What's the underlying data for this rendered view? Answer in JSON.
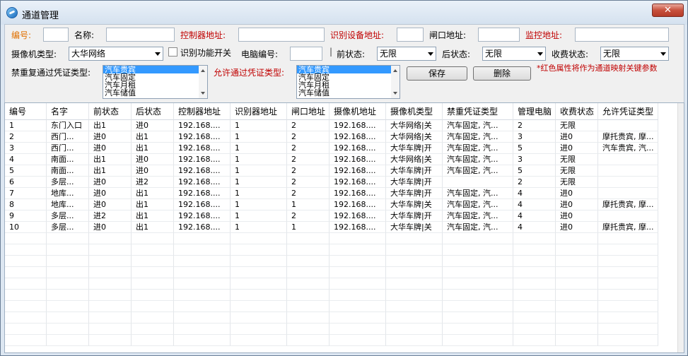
{
  "window": {
    "title": "通道管理",
    "close_label": "✕"
  },
  "form": {
    "number_label": "编号:",
    "name_label": "名称:",
    "controller_addr_label": "控制器地址:",
    "recognizer_addr_label": "识别设备地址:",
    "gate_addr_label": "闸口地址:",
    "monitor_addr_label": "监控地址:",
    "camera_type_label": "摄像机类型:",
    "camera_type_value": "大华网络",
    "recognition_switch_label": "识别功能开关",
    "pc_number_label": "电脑编号:",
    "front_state_label": "前状态:",
    "front_state_value": "无限",
    "back_state_label": "后状态:",
    "back_state_value": "无限",
    "charge_state_label": "收费状态:",
    "charge_state_value": "无限",
    "forbid_label": "禁重复通过凭证类型:",
    "allow_label": "允许通过凭证类型:",
    "forbid_list": [
      "汽车贵宾",
      "汽车固定",
      "汽车月租",
      "汽车储值"
    ],
    "allow_list": [
      "汽车贵宾",
      "汽车固定",
      "汽车月租",
      "汽车储值"
    ],
    "save_label": "保存",
    "delete_label": "删除",
    "note": "*红色属性将作为通道映射关键参数"
  },
  "table": {
    "headers": [
      "编号",
      "名字",
      "前状态",
      "后状态",
      "控制器地址",
      "识别器地址",
      "闸口地址",
      "摄像机地址",
      "摄像机类型",
      "禁重凭证类型",
      "管理电脑",
      "收费状态",
      "允许凭证类型"
    ],
    "rows": [
      [
        "1",
        "东门入口",
        "出1",
        "进0",
        "192.168....",
        "1",
        "2",
        "192.168....",
        "大华网络|关",
        "汽车固定, 汽...",
        "2",
        "无限",
        ""
      ],
      [
        "2",
        "西门...",
        "进0",
        "出1",
        "192.168....",
        "1",
        "2",
        "192.168....",
        "大华网络|关",
        "汽车固定, 汽...",
        "3",
        "进0",
        "摩托贵宾, 摩..."
      ],
      [
        "3",
        "西门...",
        "进0",
        "出1",
        "192.168....",
        "1",
        "2",
        "192.168....",
        "大华车牌|开",
        "汽车固定, 汽...",
        "5",
        "进0",
        "汽车贵宾, 汽..."
      ],
      [
        "4",
        "南面...",
        "出1",
        "进0",
        "192.168....",
        "1",
        "2",
        "192.168....",
        "大华网络|关",
        "汽车固定, 汽...",
        "3",
        "无限",
        ""
      ],
      [
        "5",
        "南面...",
        "出1",
        "进0",
        "192.168....",
        "1",
        "2",
        "192.168....",
        "大华车牌|开",
        "汽车固定, 汽...",
        "5",
        "无限",
        ""
      ],
      [
        "6",
        "多层...",
        "进0",
        "进2",
        "192.168....",
        "1",
        "2",
        "192.168....",
        "大华车牌|开",
        "",
        "2",
        "无限",
        ""
      ],
      [
        "7",
        "地库...",
        "进0",
        "出1",
        "192.168....",
        "1",
        "2",
        "192.168....",
        "大华车牌|开",
        "汽车固定, 汽...",
        "4",
        "进0",
        ""
      ],
      [
        "8",
        "地库...",
        "进0",
        "出1",
        "192.168....",
        "1",
        "1",
        "192.168....",
        "大华车牌|关",
        "汽车固定, 汽...",
        "4",
        "进0",
        "摩托贵宾, 摩..."
      ],
      [
        "9",
        "多层...",
        "进2",
        "出1",
        "192.168....",
        "1",
        "2",
        "192.168....",
        "大华车牌|开",
        "汽车固定, 汽...",
        "4",
        "进0",
        ""
      ],
      [
        "10",
        "多层...",
        "进0",
        "出1",
        "192.168....",
        "1",
        "1",
        "192.168....",
        "大华车牌|关",
        "汽车固定, 汽...",
        "4",
        "进0",
        "摩托贵宾, 摩..."
      ]
    ]
  },
  "colors": {
    "required_label": "#c00000",
    "number_label": "#e07000",
    "selection": "#3399ff"
  }
}
